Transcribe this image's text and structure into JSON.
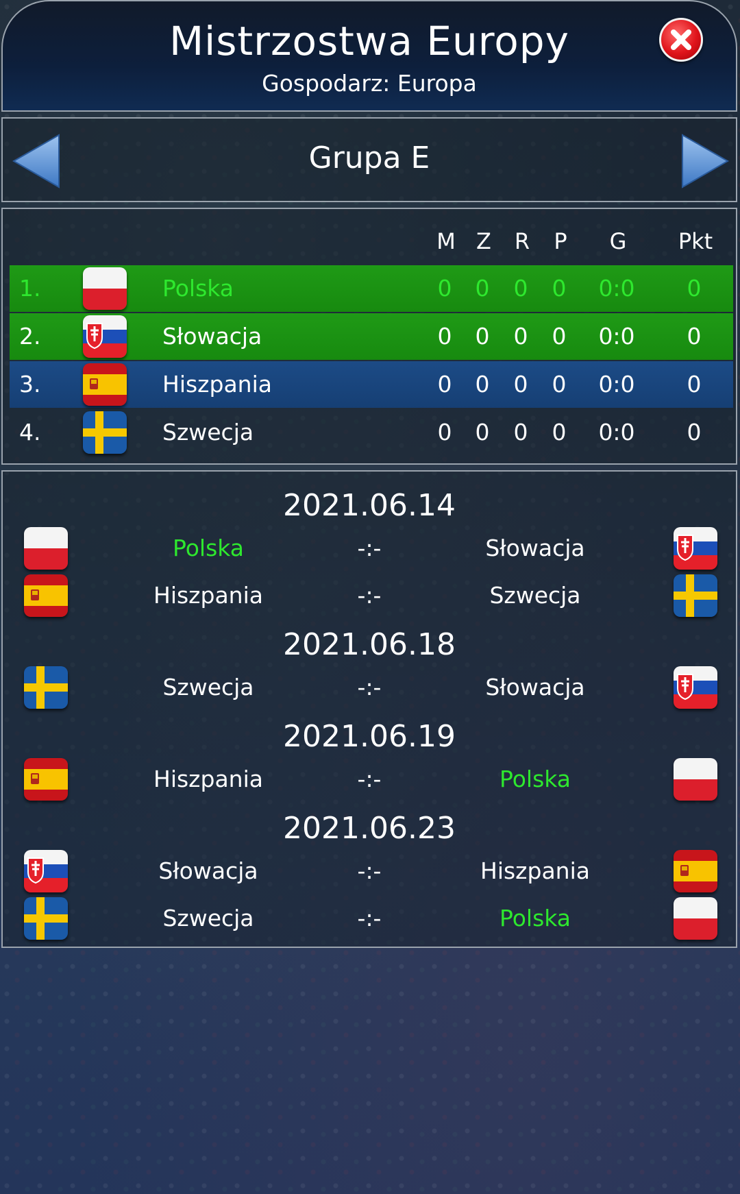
{
  "header": {
    "title": "Mistrzostwa Europy",
    "subtitle": "Gospodarz: Europa"
  },
  "group": {
    "title": "Grupa E"
  },
  "standings": {
    "columns": [
      "M",
      "Z",
      "R",
      "P",
      "G",
      "Pkt"
    ],
    "rows": [
      {
        "rank": "1.",
        "team": "Polska",
        "flag": "flag-poland",
        "m": "0",
        "z": "0",
        "r": "0",
        "p": "0",
        "g": "0:0",
        "pkt": "0"
      },
      {
        "rank": "2.",
        "team": "Słowacja",
        "flag": "flag-slovakia",
        "m": "0",
        "z": "0",
        "r": "0",
        "p": "0",
        "g": "0:0",
        "pkt": "0"
      },
      {
        "rank": "3.",
        "team": "Hiszpania",
        "flag": "flag-spain",
        "m": "0",
        "z": "0",
        "r": "0",
        "p": "0",
        "g": "0:0",
        "pkt": "0"
      },
      {
        "rank": "4.",
        "team": "Szwecja",
        "flag": "flag-sweden",
        "m": "0",
        "z": "0",
        "r": "0",
        "p": "0",
        "g": "0:0",
        "pkt": "0"
      }
    ]
  },
  "fixtures": [
    {
      "date": "2021.06.14",
      "matches": [
        {
          "home": "Polska",
          "score": "-:-",
          "away": "Słowacja"
        },
        {
          "home": "Hiszpania",
          "score": "-:-",
          "away": "Szwecja"
        }
      ]
    },
    {
      "date": "2021.06.18",
      "matches": [
        {
          "home": "Szwecja",
          "score": "-:-",
          "away": "Słowacja"
        }
      ]
    },
    {
      "date": "2021.06.19",
      "matches": [
        {
          "home": "Hiszpania",
          "score": "-:-",
          "away": "Polska"
        }
      ]
    },
    {
      "date": "2021.06.23",
      "matches": [
        {
          "home": "Słowacja",
          "score": "-:-",
          "away": "Hiszpania"
        },
        {
          "home": "Szwecja",
          "score": "-:-",
          "away": "Polska"
        }
      ]
    }
  ],
  "colors": {
    "highlight_text": "#2ee82e",
    "qualified_row": "#1f9a16",
    "playoff_row": "#1c4b86",
    "header_bg": "#0d1f3c"
  }
}
